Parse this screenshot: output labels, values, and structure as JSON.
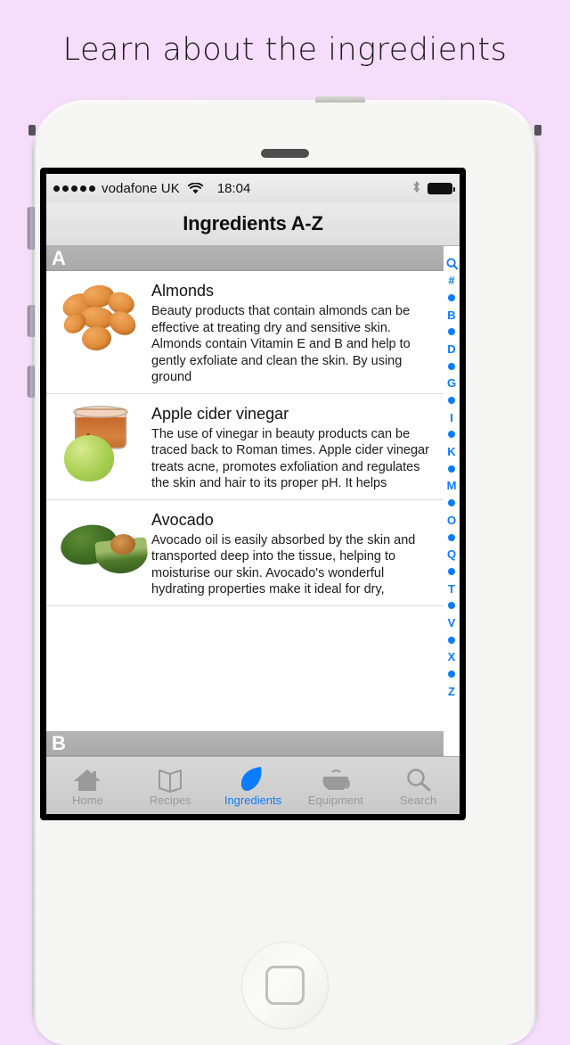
{
  "promo": {
    "heading": "Learn about the ingredients"
  },
  "status_bar": {
    "signal_dots": 5,
    "carrier": "vodafone UK",
    "wifi_icon": "wifi-icon",
    "time": "18:04",
    "bluetooth_icon": "bluetooth-icon",
    "battery_icon": "battery-full-icon"
  },
  "nav": {
    "title": "Ingredients A-Z"
  },
  "sections": {
    "current_letter": "A",
    "next_letter": "B"
  },
  "list": {
    "items": [
      {
        "thumb": "almonds-thumbnail",
        "title": "Almonds",
        "description": "Beauty products that contain almonds can be effective at treating dry and sensitive skin. Almonds contain Vitamin E and B and help to gently exfoliate and clean the skin. By using ground"
      },
      {
        "thumb": "apple-cider-vinegar-thumbnail",
        "title": "Apple cider vinegar",
        "description": "The use of vinegar in beauty products can be traced back to Roman times. Apple cider vinegar treats acne, promotes exfoliation and regulates the skin and hair to its proper pH. It helps"
      },
      {
        "thumb": "avocado-thumbnail",
        "title": "Avocado",
        "description": "Avocado oil is easily absorbed by the skin and transported deep into the tissue, helping to moisturise our skin. Avocado's wonderful hydrating properties make it ideal for dry,"
      }
    ]
  },
  "index_strip": {
    "accent_color": "#0a7cff",
    "entries": [
      {
        "type": "icon",
        "label": "search-icon"
      },
      {
        "type": "text",
        "label": "#"
      },
      {
        "type": "dot",
        "label": "•"
      },
      {
        "type": "text",
        "label": "B"
      },
      {
        "type": "dot",
        "label": "•"
      },
      {
        "type": "text",
        "label": "D"
      },
      {
        "type": "dot",
        "label": "•"
      },
      {
        "type": "text",
        "label": "G"
      },
      {
        "type": "dot",
        "label": "•"
      },
      {
        "type": "text",
        "label": "I"
      },
      {
        "type": "dot",
        "label": "•"
      },
      {
        "type": "text",
        "label": "K"
      },
      {
        "type": "dot",
        "label": "•"
      },
      {
        "type": "text",
        "label": "M"
      },
      {
        "type": "dot",
        "label": "•"
      },
      {
        "type": "text",
        "label": "O"
      },
      {
        "type": "dot",
        "label": "•"
      },
      {
        "type": "text",
        "label": "Q"
      },
      {
        "type": "dot",
        "label": "•"
      },
      {
        "type": "text",
        "label": "T"
      },
      {
        "type": "dot",
        "label": "•"
      },
      {
        "type": "text",
        "label": "V"
      },
      {
        "type": "dot",
        "label": "•"
      },
      {
        "type": "text",
        "label": "X"
      },
      {
        "type": "dot",
        "label": "•"
      },
      {
        "type": "text",
        "label": "Z"
      }
    ]
  },
  "tab_bar": {
    "active_color": "#0a7cff",
    "inactive_color": "#9a9a9a",
    "tabs": [
      {
        "icon": "home-icon",
        "label": "Home",
        "active": false
      },
      {
        "icon": "book-icon",
        "label": "Recipes",
        "active": false
      },
      {
        "icon": "leaf-icon",
        "label": "Ingredients",
        "active": true
      },
      {
        "icon": "teapot-icon",
        "label": "Equipment",
        "active": false
      },
      {
        "icon": "search-icon",
        "label": "Search",
        "active": false
      }
    ]
  },
  "device": {
    "camera": "front-camera",
    "speaker": "earpiece-speaker",
    "home_button": "home-button",
    "silent_switch": "silent-switch",
    "volume_up": "volume-up-button",
    "volume_down": "volume-down-button",
    "power": "power-button"
  }
}
